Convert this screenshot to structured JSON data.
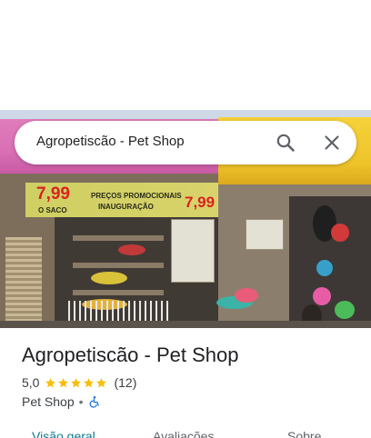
{
  "search": {
    "query": "Agropetiscão - Pet Shop"
  },
  "photo": {
    "banner_price_left": "7,99",
    "banner_price_right": "7,99",
    "banner_line1": "PREÇOS PROMOCIONAIS",
    "banner_line2": "INAUGURAÇÃO",
    "banner_word": "O SACO"
  },
  "place": {
    "name": "Agropetiscão - Pet Shop",
    "rating": "5,0",
    "star_count": 5,
    "reviews_count": "(12)",
    "category": "Pet Shop",
    "separator": "•"
  },
  "tabs": {
    "overview": "Visão geral",
    "reviews": "Avaliações",
    "about": "Sobre"
  },
  "colors": {
    "star": "#fbbc04",
    "accessibility_icon": "#1a73e8",
    "active_tab": "#0b7a8f"
  },
  "icons": {
    "search": "search-icon",
    "close": "close-icon",
    "wheelchair": "wheelchair-accessible-icon",
    "star": "star-icon"
  }
}
